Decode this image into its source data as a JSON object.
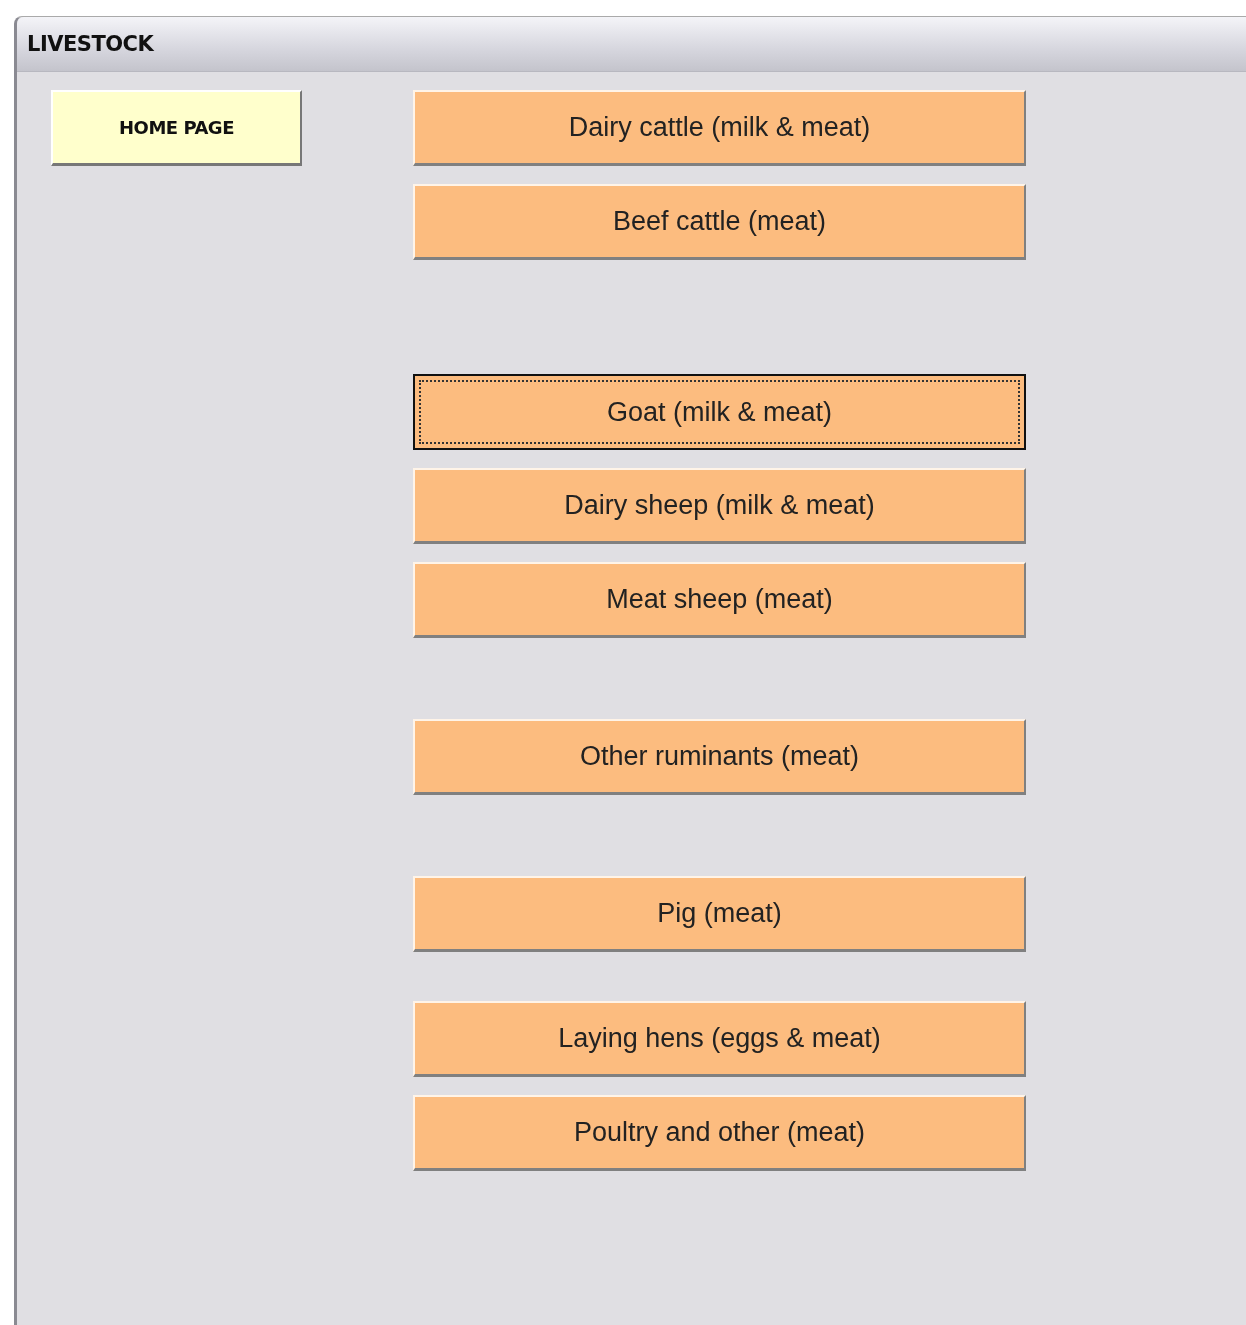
{
  "window": {
    "title": "LIVESTOCK"
  },
  "home_button": {
    "label": "HOME PAGE"
  },
  "groups": [
    {
      "buttons": [
        {
          "label": "Dairy cattle (milk & meat)",
          "focused": false
        },
        {
          "label": "Beef cattle (meat)",
          "focused": false
        }
      ]
    },
    {
      "buttons": [
        {
          "label": "Goat (milk & meat)",
          "focused": true
        },
        {
          "label": "Dairy sheep (milk & meat)",
          "focused": false
        },
        {
          "label": "Meat sheep (meat)",
          "focused": false
        }
      ]
    },
    {
      "buttons": [
        {
          "label": "Other ruminants (meat)",
          "focused": false
        }
      ]
    },
    {
      "buttons": [
        {
          "label": "Pig (meat)",
          "focused": false
        }
      ]
    },
    {
      "buttons": [
        {
          "label": "Laying hens (eggs & meat)",
          "focused": false
        },
        {
          "label": "Poultry and other (meat)",
          "focused": false
        }
      ]
    }
  ]
}
